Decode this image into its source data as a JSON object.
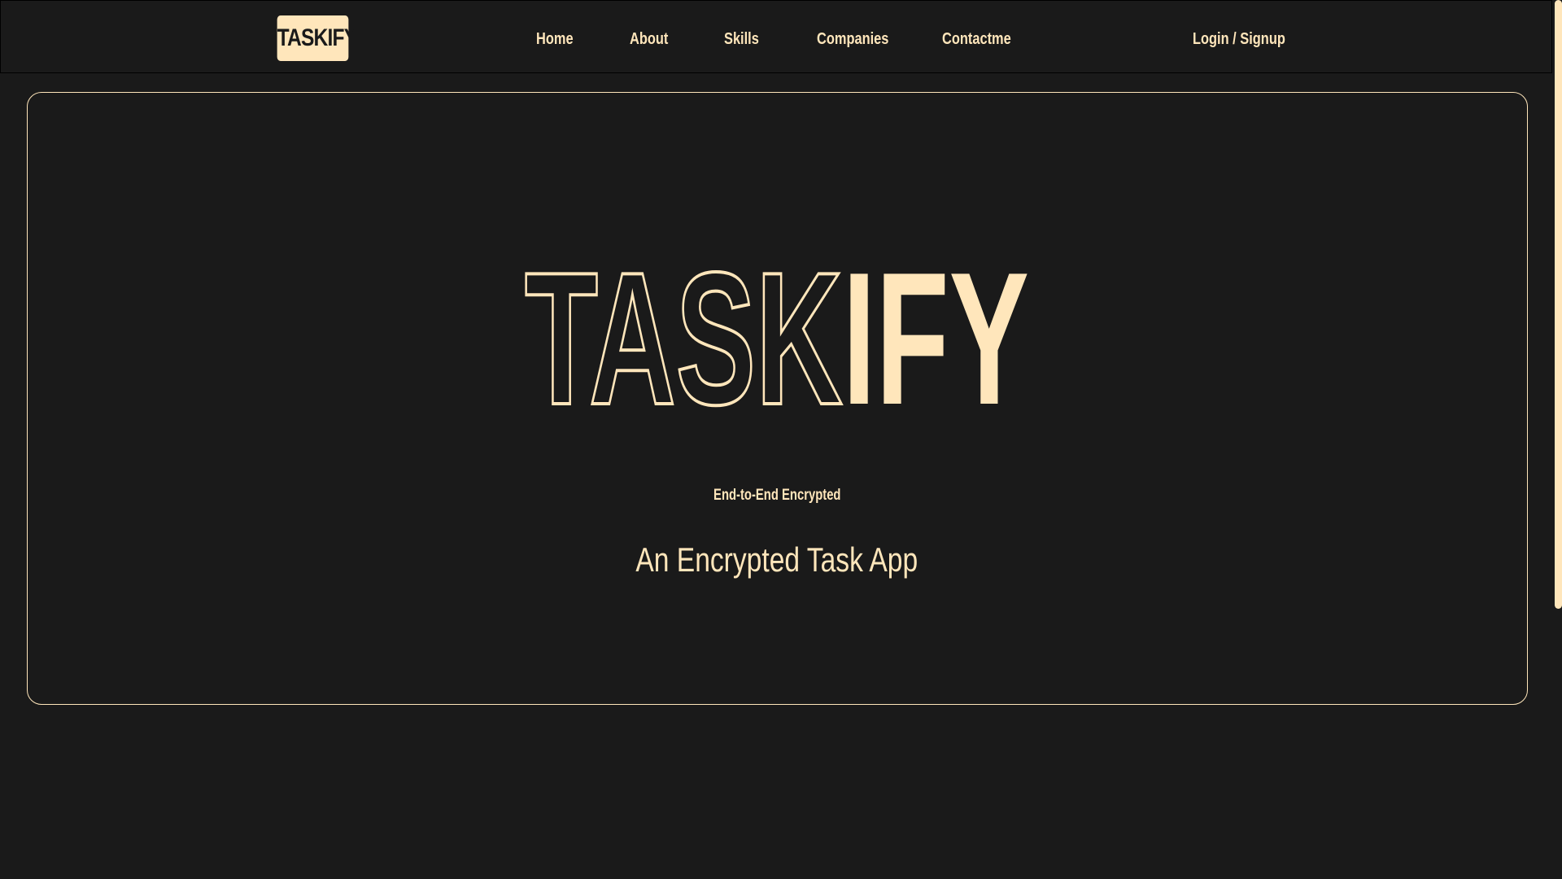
{
  "brand": {
    "logo_text": "TASKIFY"
  },
  "nav": {
    "items": [
      {
        "label": "Home"
      },
      {
        "label": "About"
      },
      {
        "label": "Skills"
      },
      {
        "label": "Companies"
      },
      {
        "label": "Contactme"
      }
    ],
    "auth_label": "Login / Signup"
  },
  "hero": {
    "title_outline": "TASK",
    "title_filled": "IFY",
    "tagline": "End-to-End Encrypted",
    "subtitle": "An Encrypted Task App"
  },
  "colors": {
    "background": "#1a1a1a",
    "accent": "#ffe6bb"
  }
}
